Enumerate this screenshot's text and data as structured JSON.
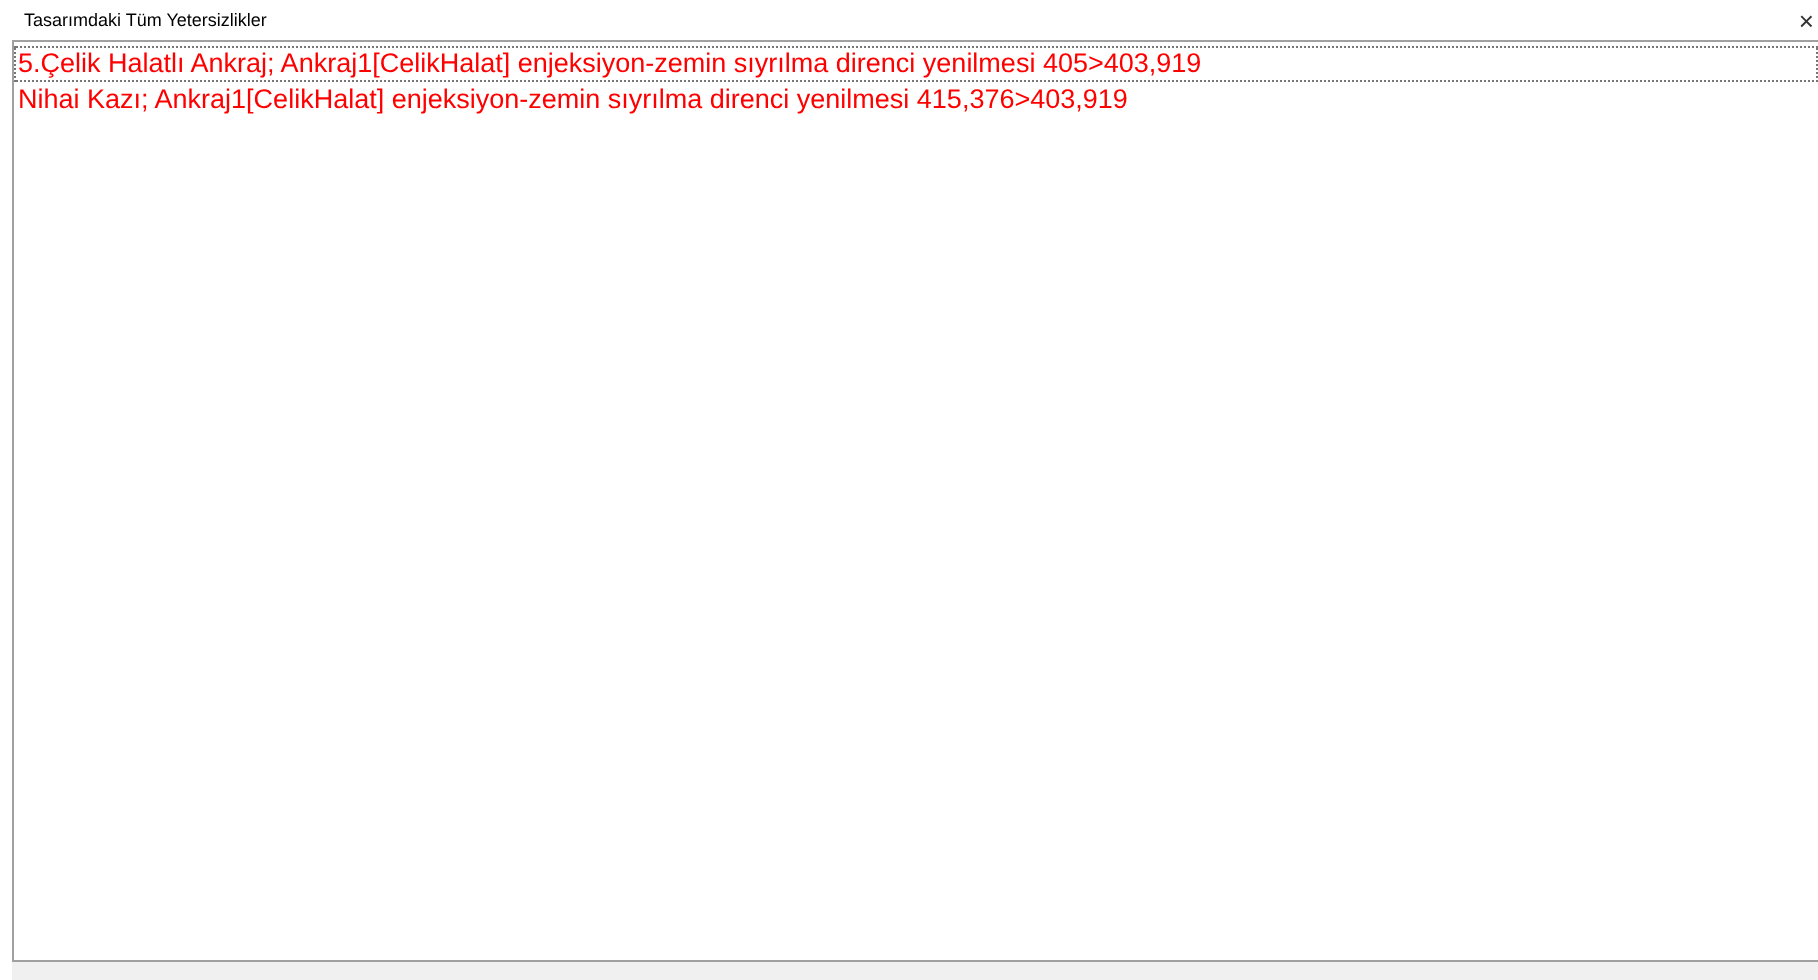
{
  "window": {
    "title": "Tasarımdaki Tüm Yetersizlikler",
    "close": "×"
  },
  "items": [
    {
      "text": "5.Çelik Halatlı Ankraj; Ankraj1[CelikHalat] enjeksiyon-zemin sıyrılma direnci yenilmesi 405>403,919",
      "selected": true
    },
    {
      "text": "Nihai Kazı; Ankraj1[CelikHalat] enjeksiyon-zemin sıyrılma direnci yenilmesi 415,376>403,919",
      "selected": false
    }
  ]
}
